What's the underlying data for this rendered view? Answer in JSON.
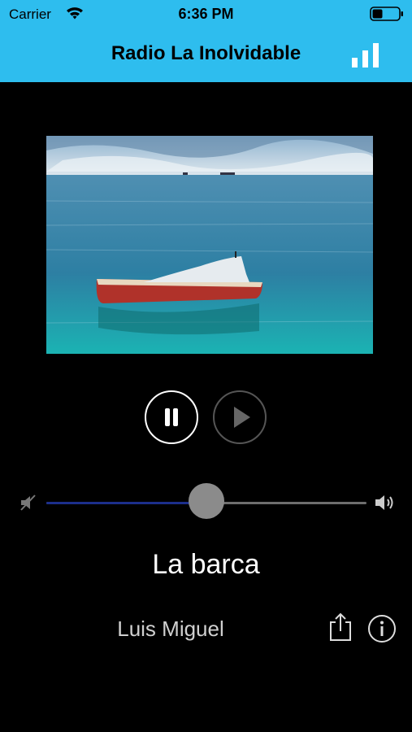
{
  "status_bar": {
    "carrier": "Carrier",
    "time": "6:36 PM",
    "icons": [
      "wifi-icon",
      "battery-icon"
    ]
  },
  "header": {
    "title": "Radio La Inolvidable",
    "background": "#2ebdee",
    "icon": "signal-bars-icon"
  },
  "artwork": {
    "subject": "red-boat-on-sea"
  },
  "controls": {
    "pause_icon": "pause-icon",
    "play_icon": "play-icon",
    "pause_enabled": true,
    "play_enabled": false
  },
  "volume": {
    "level": 0.5,
    "min_icon": "volume-mute-icon",
    "max_icon": "volume-high-icon",
    "fill_color": "#1c2f8c"
  },
  "track": {
    "song": "La barca",
    "artist": "Luis Miguel"
  },
  "actions": {
    "share_icon": "share-icon",
    "info_icon": "info-icon"
  }
}
